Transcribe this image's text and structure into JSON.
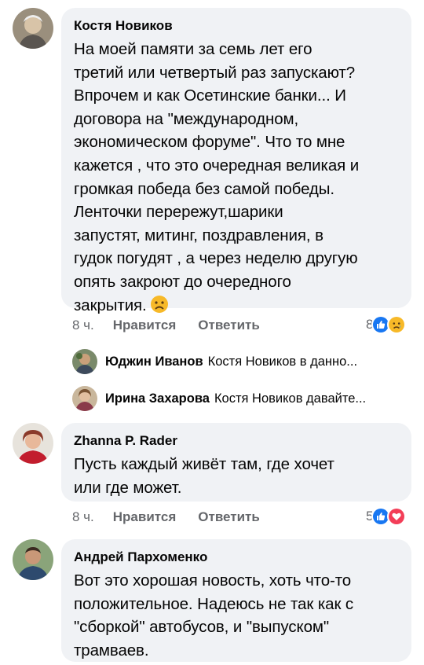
{
  "comments": [
    {
      "author": "Костя Новиков",
      "lines": [
        "На моей памяти за семь лет его",
        "третий или четвертый раз запускают?",
        "Впрочем и как Осетинские банки... И",
        "договора на \"международном,",
        "экономическом форуме\". Что то мне",
        "кажется , что это очередная великая и",
        "громкая победа без самой победы.",
        "Ленточки перережут,шарики",
        "запустят, митинг, поздравления, в",
        "гудок погудят , а через неделю другую",
        "опять закроют до очередного",
        "закрытия."
      ],
      "trailing_emoji": "sad-face",
      "time": "8 ч.",
      "like_label": "Нравится",
      "reply_label": "Ответить",
      "reaction_count": "8",
      "reactions": [
        "like",
        "sad"
      ]
    },
    {
      "author": "Zhanna P. Rader",
      "lines": [
        "Пусть каждый живёт там, где хочет",
        "или где может."
      ],
      "time": "8 ч.",
      "like_label": "Нравится",
      "reply_label": "Ответить",
      "reaction_count": "5",
      "reactions": [
        "like",
        "love"
      ]
    },
    {
      "author": "Андрей Пархоменко",
      "lines": [
        "Вот это хорошая новость, хоть что-то",
        "положительное. Надеюсь не так как с",
        "\"сборкой\" автобусов, и \"выпуском\"",
        "трамваев."
      ]
    }
  ],
  "replies": [
    {
      "name": "Юджин Иванов",
      "preview": "Костя Новиков в данно..."
    },
    {
      "name": "Ирина Захарова",
      "preview": "Костя Новиков давайте..."
    }
  ],
  "colors": {
    "bubble": "#f0f2f5",
    "meta": "#65676b",
    "like_blue": "#1877f2",
    "love_red": "#f33e58",
    "sad_yellow": "#f7b928"
  }
}
